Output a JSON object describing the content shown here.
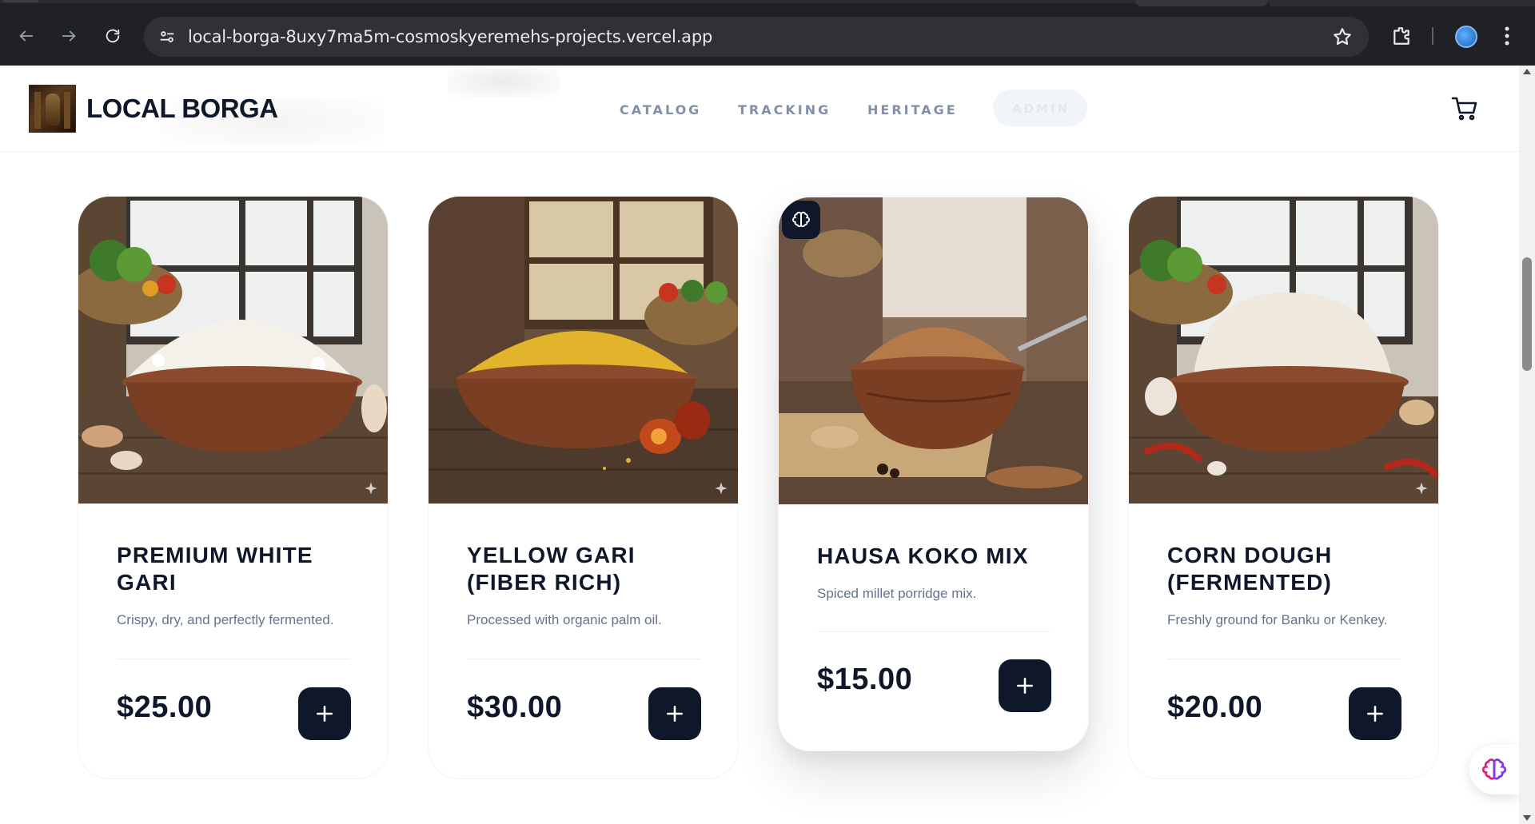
{
  "browser": {
    "url": "local-borga-8uxy7ma5m-cosmoskyeremehs-projects.vercel.app"
  },
  "header": {
    "brand": "LOCAL BORGA",
    "nav": [
      {
        "label": "CATALOG"
      },
      {
        "label": "TRACKING"
      },
      {
        "label": "HERITAGE"
      },
      {
        "label": "ADMIN"
      }
    ]
  },
  "products": [
    {
      "title": "PREMIUM WHITE GARI",
      "description": "Crispy, dry, and perfectly fermented.",
      "price": "$25.00",
      "powder_color": "#f4f1ea"
    },
    {
      "title": "YELLOW GARI (FIBER RICH)",
      "description": "Processed with organic palm oil.",
      "price": "$30.00",
      "powder_color": "#e2b42b"
    },
    {
      "title": "HAUSA KOKO MIX",
      "description": "Spiced millet porridge mix.",
      "price": "$15.00",
      "powder_color": "#b57a4a"
    },
    {
      "title": "CORN DOUGH (FERMENTED)",
      "description": "Freshly ground for Banku or Kenkey.",
      "price": "$20.00",
      "powder_color": "#efe9dd"
    }
  ],
  "colors": {
    "ink": "#0f172a",
    "muted": "#64748b",
    "nav": "#8190a5"
  }
}
